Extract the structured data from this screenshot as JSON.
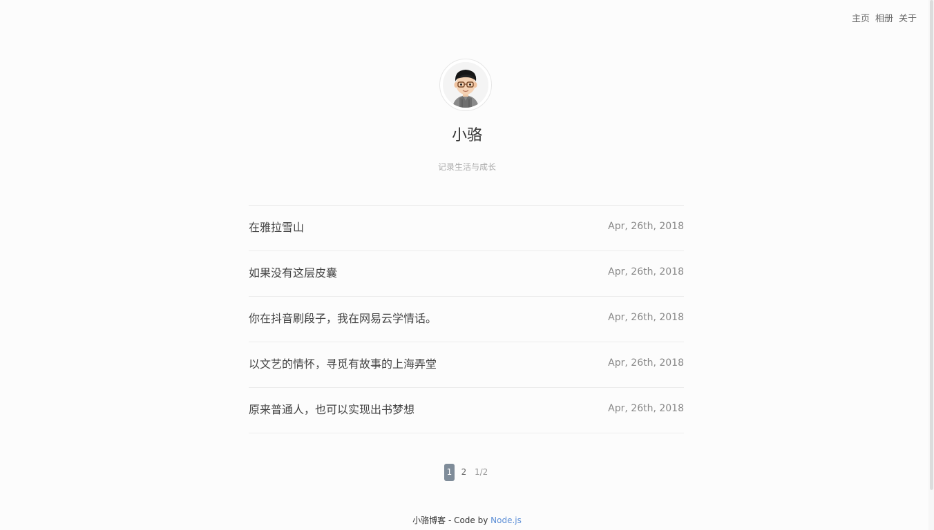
{
  "nav": {
    "items": [
      "主页",
      "相册",
      "关于"
    ]
  },
  "profile": {
    "name": "小骆",
    "subtitle": "记录生活与成长",
    "avatar_icon": "cartoon-avatar-glasses"
  },
  "posts": [
    {
      "title": "在雅拉雪山",
      "date": "Apr, 26th, 2018"
    },
    {
      "title": "如果没有这层皮囊",
      "date": "Apr, 26th, 2018"
    },
    {
      "title": "你在抖音刷段子，我在网易云学情话。",
      "date": "Apr, 26th, 2018"
    },
    {
      "title": "以文艺的情怀，寻觅有故事的上海弄堂",
      "date": "Apr, 26th, 2018"
    },
    {
      "title": "原来普通人，也可以实现出书梦想",
      "date": "Apr, 26th, 2018"
    }
  ],
  "pagination": {
    "pages": [
      "1",
      "2"
    ],
    "current": "1",
    "info": "1/2"
  },
  "footer": {
    "prefix": "小骆博客 - Code by ",
    "link": "Node.js"
  },
  "colors": {
    "background": "#fcfcfc",
    "active_page": "#7f8c99",
    "footer_link": "#5c8ed6"
  }
}
